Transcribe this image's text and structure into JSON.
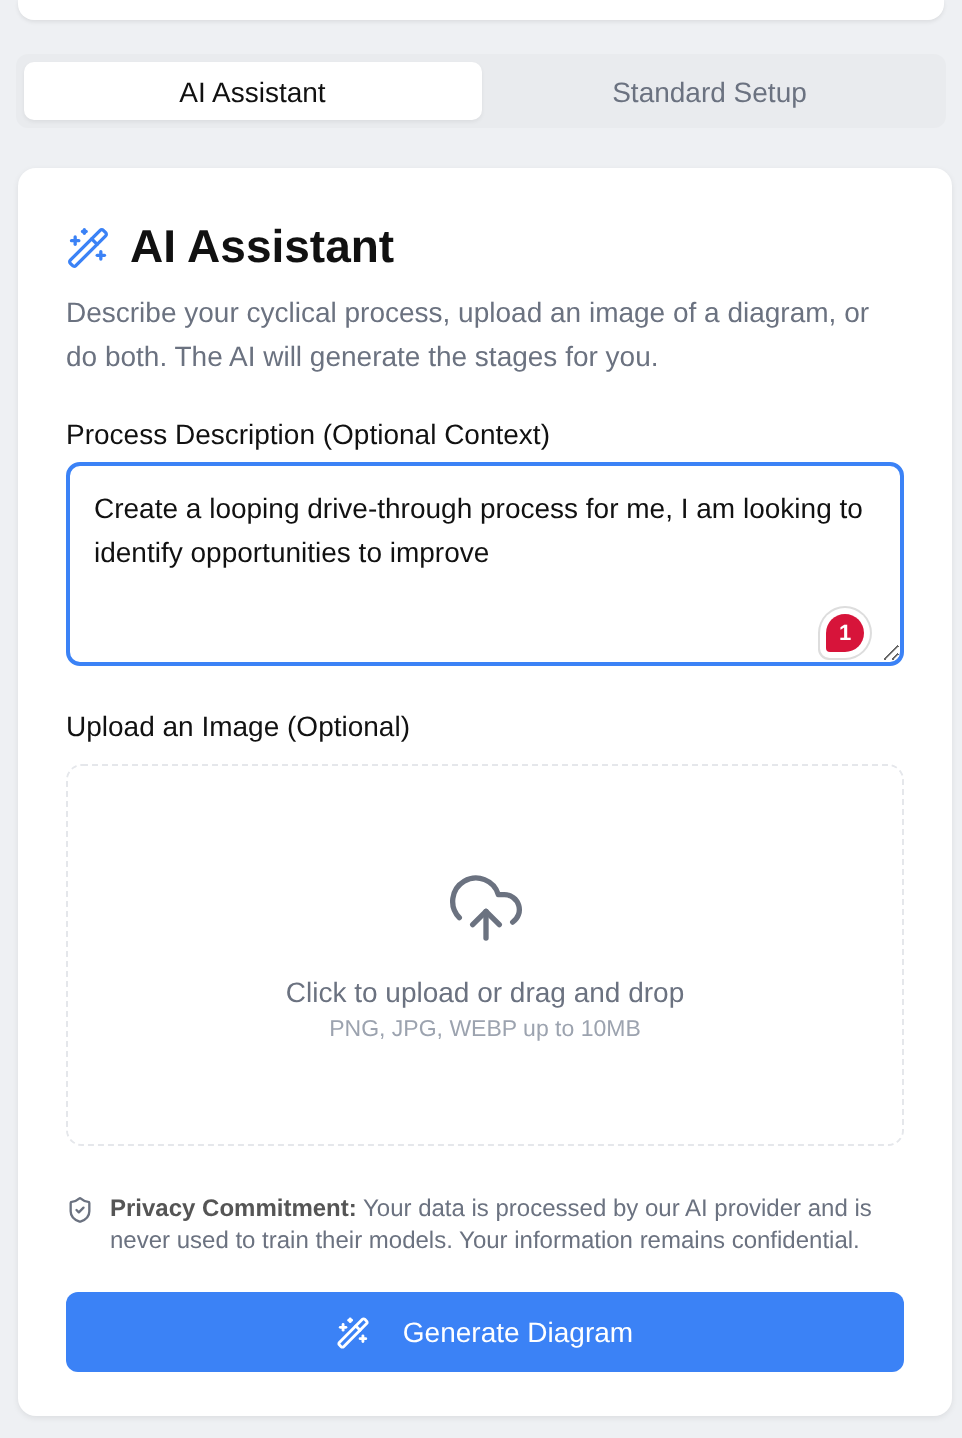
{
  "tabs": [
    {
      "label": "AI Assistant",
      "selected": true
    },
    {
      "label": "Standard Setup",
      "selected": false
    }
  ],
  "card": {
    "title": "AI Assistant",
    "description": "Describe your cyclical process, upload an image of a diagram, or do both. The AI will generate the stages for you.",
    "description_field": {
      "label": "Process Description (Optional Context)",
      "value": "Create a looping drive-through process for me, I am looking to identify opportunities to improve",
      "focused": true,
      "badge": "1"
    },
    "upload": {
      "label": "Upload an Image (Optional)",
      "prompt": "Click to upload or drag and drop",
      "hint": "PNG, JPG, WEBP up to 10MB"
    },
    "privacy": "**Privacy Commitment:** Your data is processed by our AI provider and is never used to train their models. Your information remains confidential.",
    "button": "Generate Diagram"
  }
}
